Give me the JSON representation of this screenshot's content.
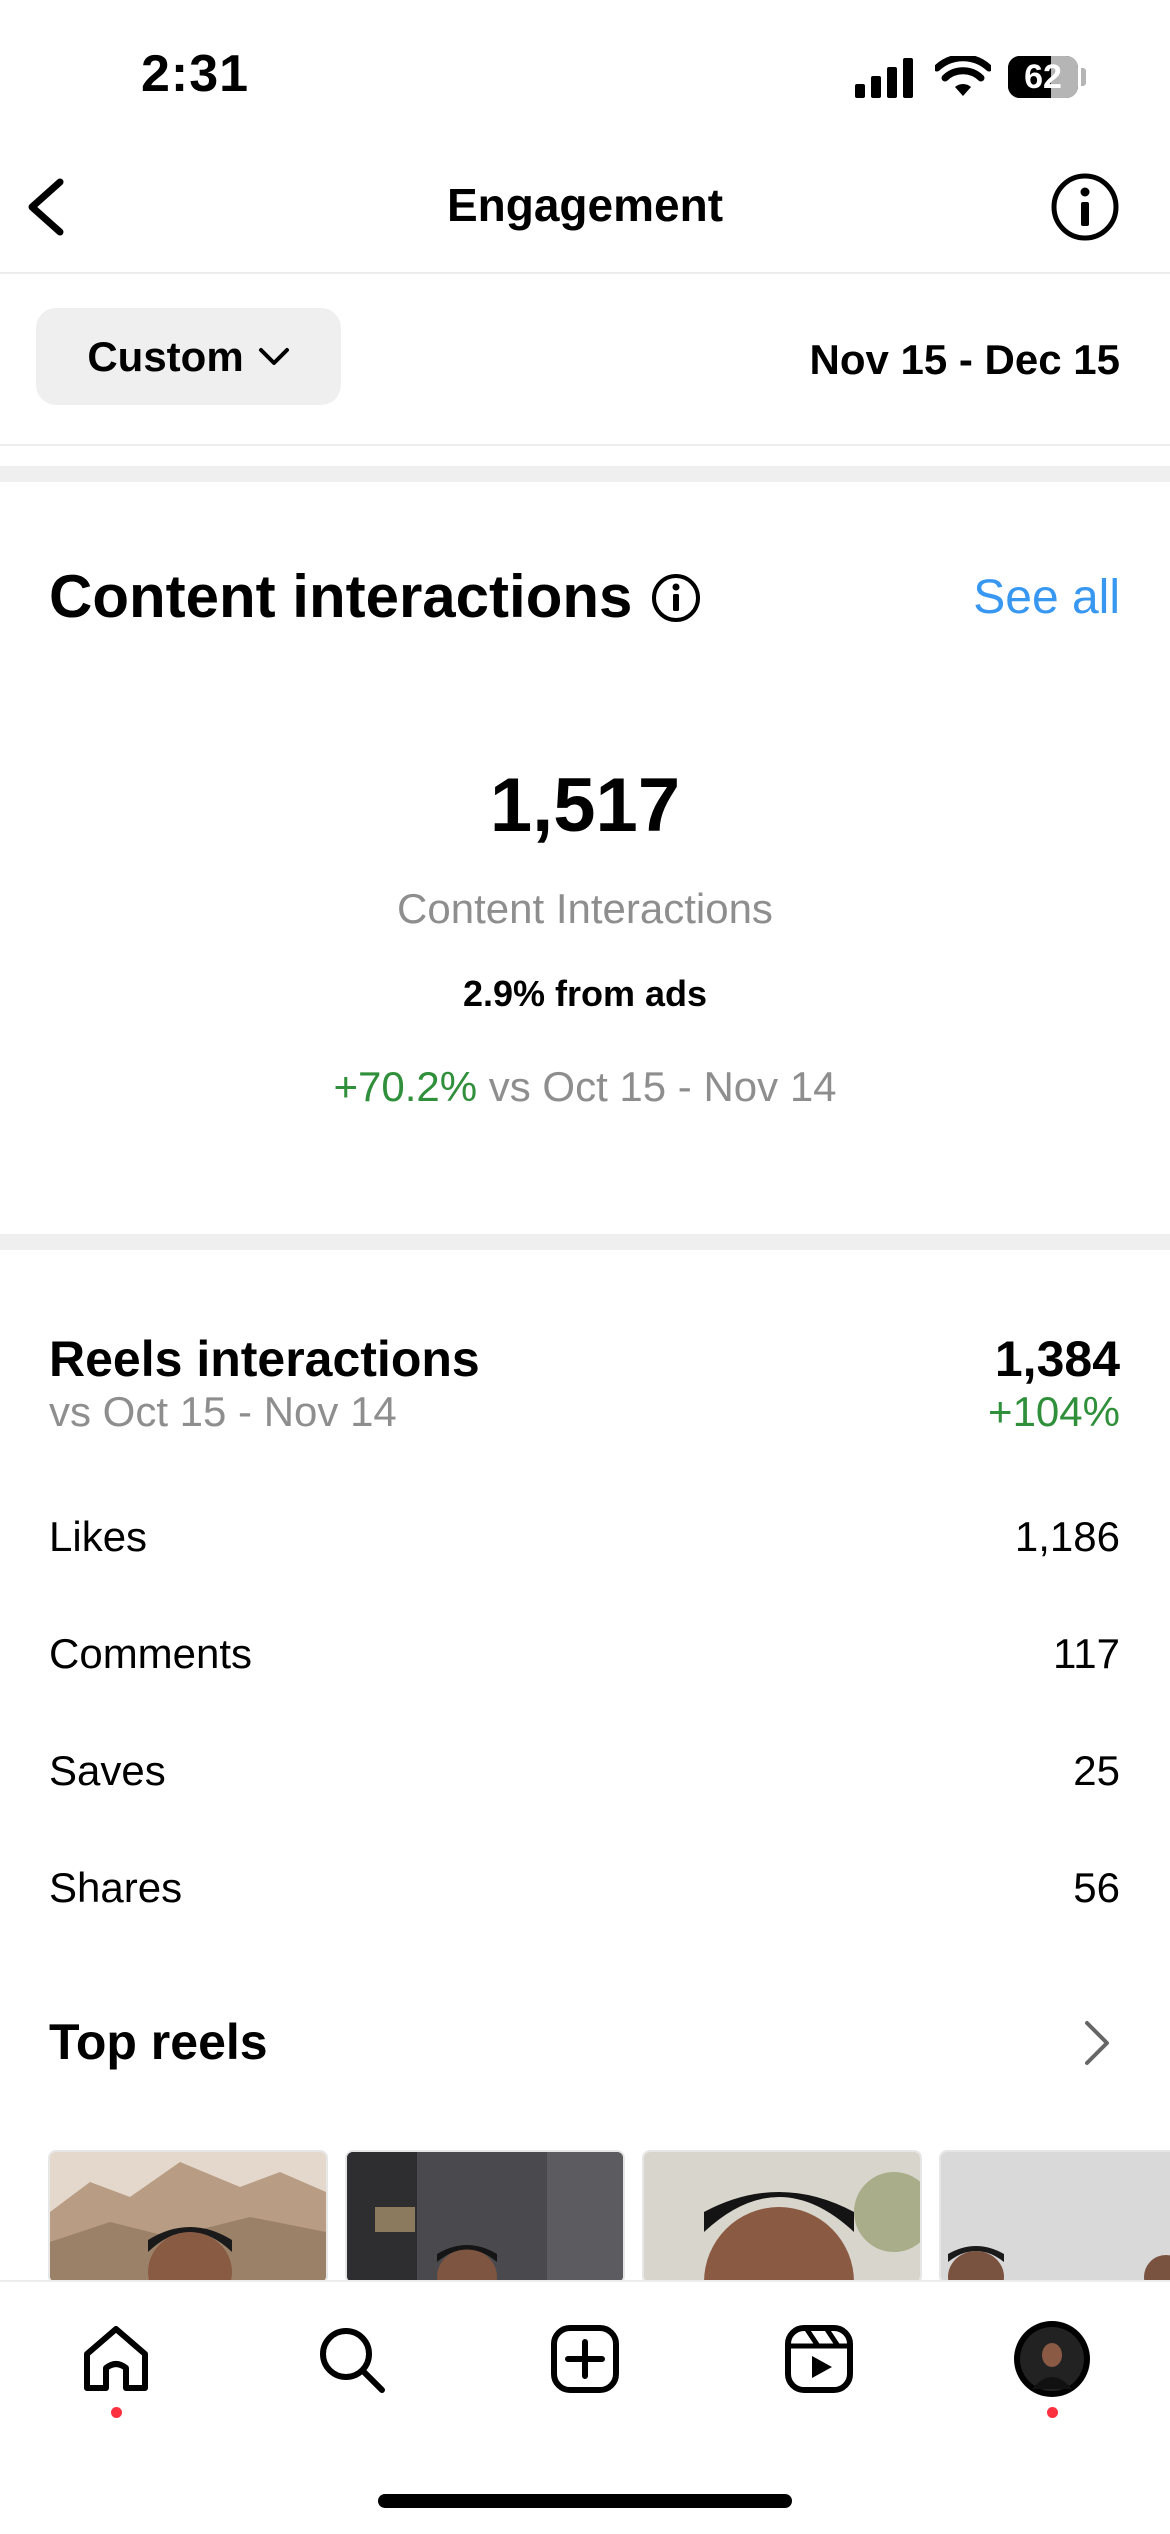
{
  "status_bar": {
    "time": "2:31",
    "battery": "62",
    "battery_level": 0.62
  },
  "header": {
    "title": "Engagement",
    "back_icon": "chevron-left-icon",
    "info_icon": "info-icon"
  },
  "filter": {
    "period": "Custom",
    "date_range": "Nov 15 - Dec 15"
  },
  "content_interactions": {
    "title": "Content interactions",
    "see_all": "See all",
    "total": "1,517",
    "label": "Content Interactions",
    "ads_share": "2.9% from ads",
    "change": "+70.2%",
    "compare": "vs Oct 15 - Nov 14"
  },
  "reels_interactions": {
    "title": "Reels interactions",
    "subtitle": "vs Oct 15 - Nov 14",
    "total": "1,384",
    "change": "+104%",
    "rows": [
      {
        "label": "Likes",
        "value": "1,186"
      },
      {
        "label": "Comments",
        "value": "117"
      },
      {
        "label": "Saves",
        "value": "25"
      },
      {
        "label": "Shares",
        "value": "56"
      }
    ]
  },
  "top_reels": {
    "title": "Top reels"
  },
  "tab_bar": {
    "tabs": [
      "home-icon",
      "search-icon",
      "create-icon",
      "reels-icon",
      "profile-avatar"
    ],
    "notification_color": "#ff3040"
  },
  "colors": {
    "accent": "#3897f0",
    "positive": "#2f8f3a",
    "secondary_text": "#8e8e8e"
  }
}
